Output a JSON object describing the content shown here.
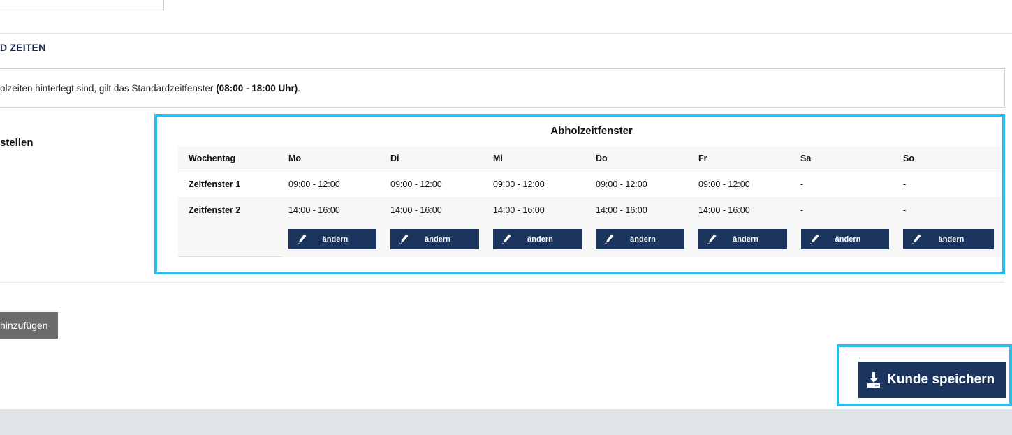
{
  "section": {
    "title": "D ZEITEN",
    "info_prefix": "olzeiten hinterlegt sind, gilt das Standardzeitfenster ",
    "info_bold": "(08:00 - 18:00 Uhr)",
    "info_suffix": ".",
    "left_label": "stellen"
  },
  "pickup_table": {
    "title": "Abholzeitfenster",
    "header_label": "Wochentag",
    "days": [
      "Mo",
      "Di",
      "Mi",
      "Do",
      "Fr",
      "Sa",
      "So"
    ],
    "rows": [
      {
        "label": "Zeitfenster 1",
        "values": [
          "09:00 - 12:00",
          "09:00 - 12:00",
          "09:00 - 12:00",
          "09:00 - 12:00",
          "09:00 - 12:00",
          "-",
          "-"
        ]
      },
      {
        "label": "Zeitfenster 2",
        "values": [
          "14:00 - 16:00",
          "14:00 - 16:00",
          "14:00 - 16:00",
          "14:00 - 16:00",
          "14:00 - 16:00",
          "-",
          "-"
        ]
      }
    ],
    "edit_label": "ändern",
    "edit_icon": "pencil-icon"
  },
  "add_button": {
    "label": "hinzufügen"
  },
  "save_button": {
    "label": "Kunde speichern",
    "icon": "download-icon"
  },
  "colors": {
    "highlight": "#29bdf0",
    "button_navy": "#1c355e",
    "add_button_grey": "#6b6b6b",
    "footer": "#dfe5e8"
  }
}
